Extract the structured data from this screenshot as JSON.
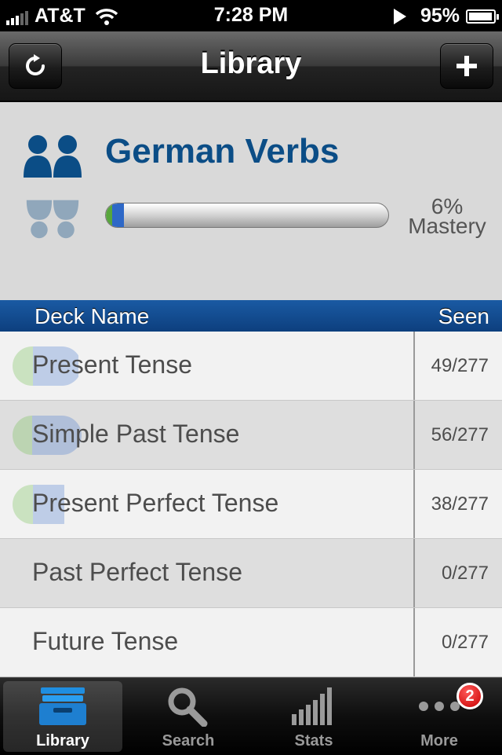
{
  "status_bar": {
    "carrier": "AT&T",
    "time": "7:28 PM",
    "battery_percent": "95%",
    "signal_bars": 3
  },
  "nav": {
    "title": "Library",
    "left_button_icon": "refresh-icon",
    "right_button_icon": "plus-icon"
  },
  "deck": {
    "title": "German Verbs",
    "mastery_percent": "6%",
    "mastery_label": "Mastery",
    "mastery_fraction": 0.06
  },
  "table": {
    "col_name": "Deck Name",
    "col_seen": "Seen",
    "rows": [
      {
        "name": "Present Tense",
        "seen": "49/277",
        "known_fraction": 0.3,
        "seen_fraction": 0.95
      },
      {
        "name": "Simple Past Tense",
        "seen": "56/277",
        "known_fraction": 0.28,
        "seen_fraction": 1.0
      },
      {
        "name": "Present Perfect Tense",
        "seen": "38/277",
        "known_fraction": 0.3,
        "seen_fraction": 0.75
      },
      {
        "name": "Past Perfect Tense",
        "seen": "0/277",
        "known_fraction": 0,
        "seen_fraction": 0
      },
      {
        "name": "Future Tense",
        "seen": "0/277",
        "known_fraction": 0,
        "seen_fraction": 0
      }
    ]
  },
  "tabs": [
    {
      "label": "Library",
      "icon": "library-tray-icon",
      "active": true
    },
    {
      "label": "Search",
      "icon": "magnifier-icon",
      "active": false
    },
    {
      "label": "Stats",
      "icon": "bar-stats-icon",
      "active": false
    },
    {
      "label": "More",
      "icon": "more-dots-icon",
      "active": false,
      "badge": "2"
    }
  ],
  "colors": {
    "accent_blue": "#0b4d86",
    "header_blue": "#0d3f7e",
    "known_green": "#6fbf4f",
    "seen_blue": "#4a7bd0",
    "badge_red": "#c80000"
  }
}
